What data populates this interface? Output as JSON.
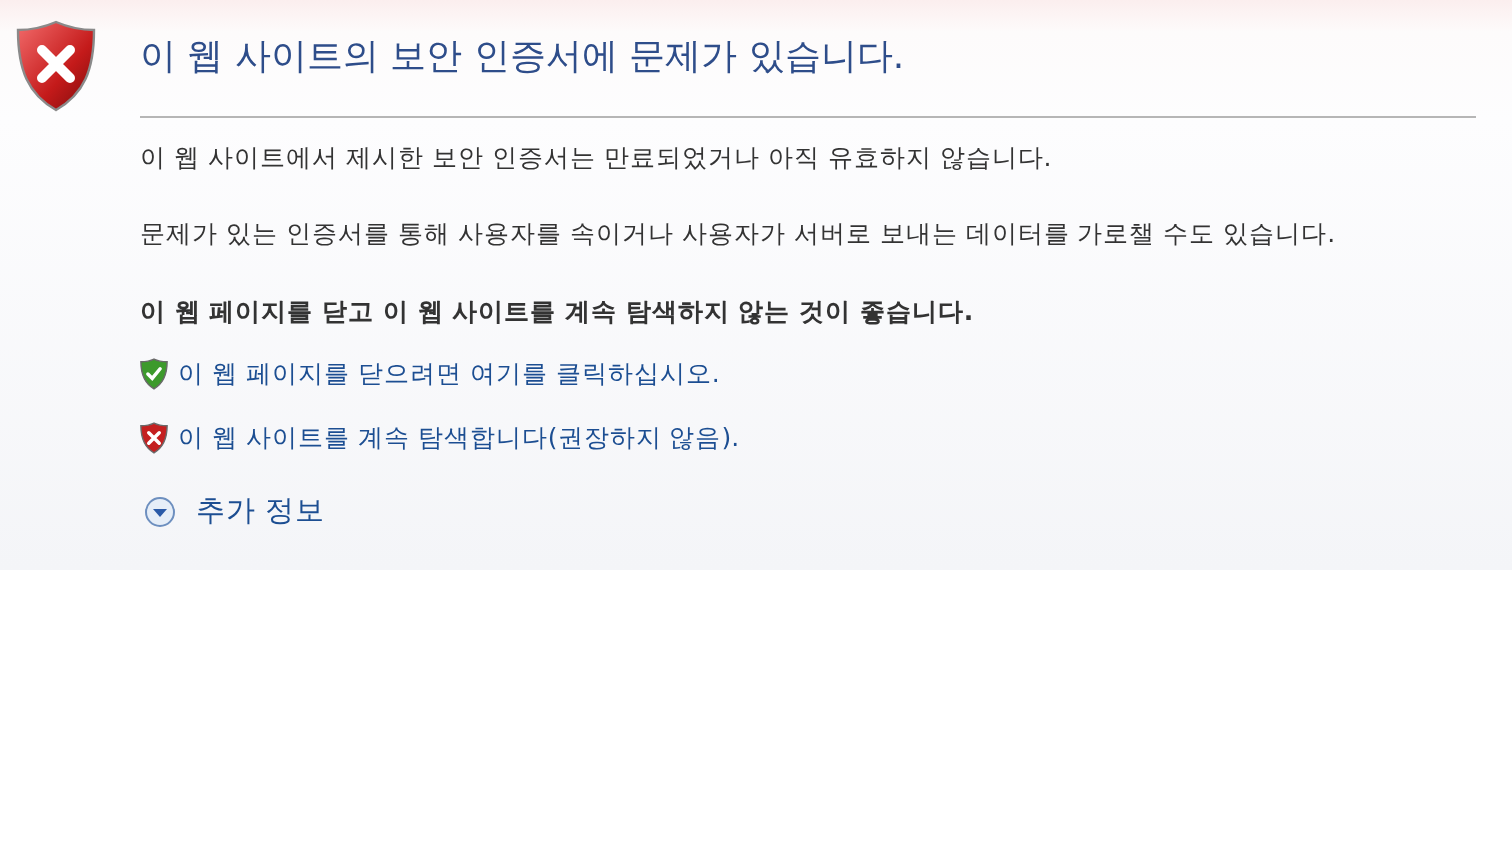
{
  "title": "이 웹 사이트의 보안 인증서에 문제가 있습니다.",
  "paragraphs": [
    "이 웹 사이트에서 제시한 보안 인증서는 만료되었거나 아직 유효하지 않습니다.",
    "문제가 있는 인증서를 통해 사용자를 속이거나 사용자가 서버로 보내는 데이터를 가로챌 수도 있습니다."
  ],
  "recommendation": "이 웹 페이지를 닫고 이 웹 사이트를 계속 탐색하지 않는 것이 좋습니다.",
  "links": [
    {
      "kind": "safe",
      "label": "이 웹 페이지를 닫으려면 여기를 클릭하십시오."
    },
    {
      "kind": "unsafe",
      "label": "이 웹 사이트를 계속 탐색합니다(권장하지 않음)."
    }
  ],
  "more_info": {
    "label": "추가 정보",
    "expanded": false
  }
}
